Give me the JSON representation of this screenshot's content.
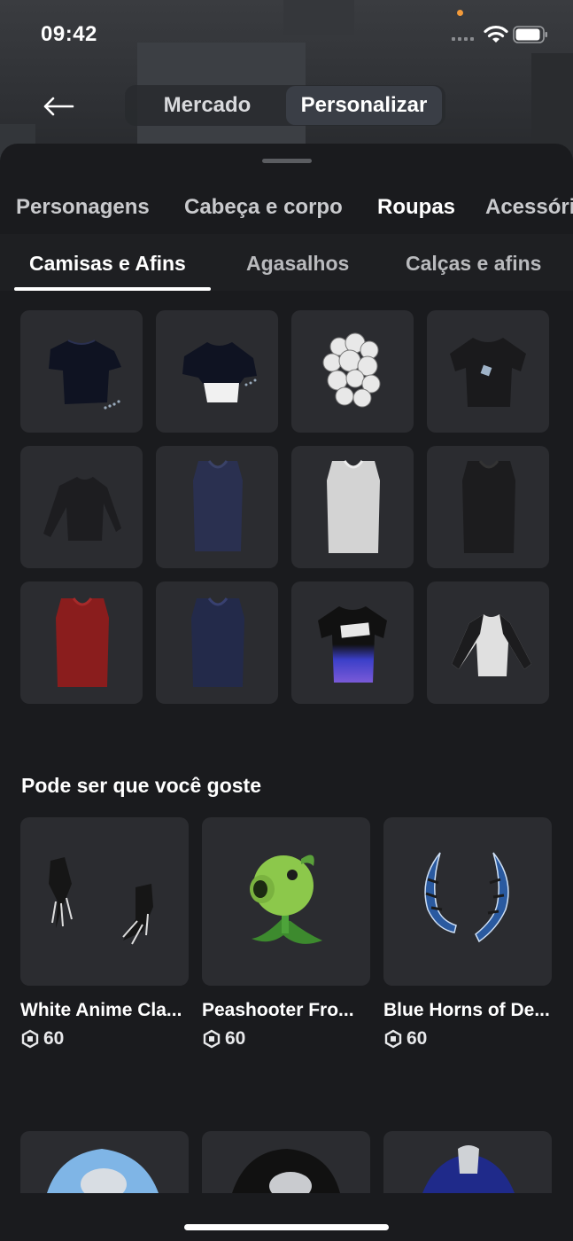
{
  "status_bar": {
    "time": "09:42"
  },
  "header": {
    "segments": [
      {
        "label": "Mercado",
        "active": false
      },
      {
        "label": "Personalizar",
        "active": true
      }
    ]
  },
  "categories": [
    {
      "label": "Personagens",
      "active": false
    },
    {
      "label": "Cabeça e corpo",
      "active": false
    },
    {
      "label": "Roupas",
      "active": true
    },
    {
      "label": "Acessórios",
      "active": false
    }
  ],
  "subtabs": [
    {
      "label": "Camisas e Afins",
      "active": true
    },
    {
      "label": "Agasalhos",
      "active": false
    },
    {
      "label": "Calças e afins",
      "active": false
    }
  ],
  "grid_items": [
    "navy-tshirt-icon",
    "navy-crop-top-icon",
    "white-roses-shirt-icon",
    "black-logo-tshirt-icon",
    "black-longsleeve-icon",
    "navy-tank-top-icon",
    "white-tank-top-icon",
    "black-tank-top-icon",
    "red-tank-top-icon",
    "navy-tank-top-2-icon",
    "graphic-gradient-tshirt-icon",
    "raglan-longsleeve-icon"
  ],
  "recommendations": {
    "title": "Pode ser que você goste",
    "currency_icon": "robux-icon",
    "items": [
      {
        "name": "White Anime Cla...",
        "price": "60",
        "icon": "anime-claws-icon"
      },
      {
        "name": "Peashooter Fro...",
        "price": "60",
        "icon": "peashooter-icon"
      },
      {
        "name": "Blue Horns of De...",
        "price": "60",
        "icon": "blue-horns-icon"
      }
    ]
  },
  "colors": {
    "background": "#1a1b1e",
    "tile": "#2b2c30",
    "active_text": "#ffffff"
  }
}
